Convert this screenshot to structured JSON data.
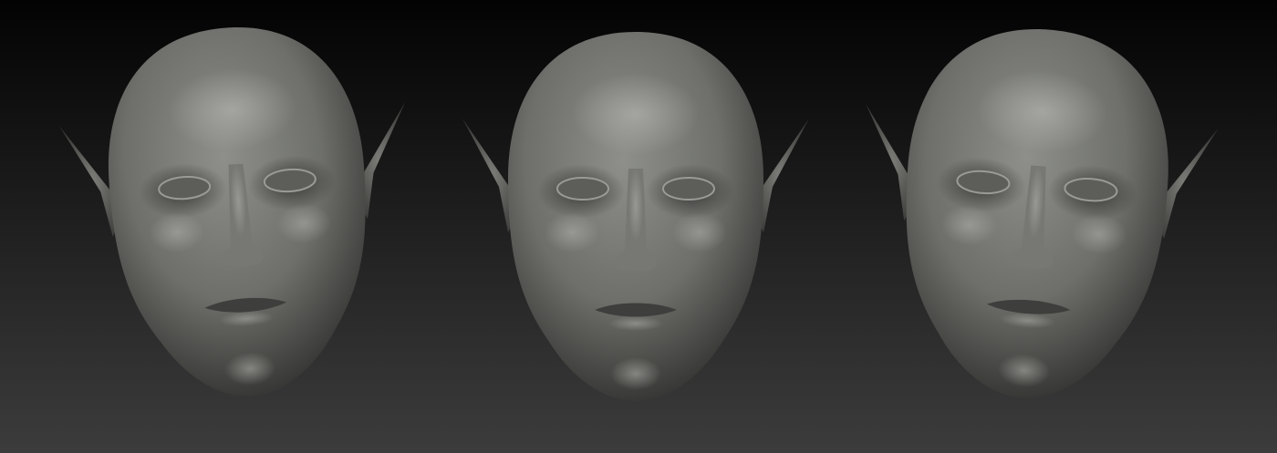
{
  "background": {
    "top": "#030303",
    "bottom": "#3c3c3c"
  },
  "sculpt": {
    "base": "#6e6f6b",
    "highlight": "#b5b6b1",
    "shadow": "#2a2a28"
  }
}
